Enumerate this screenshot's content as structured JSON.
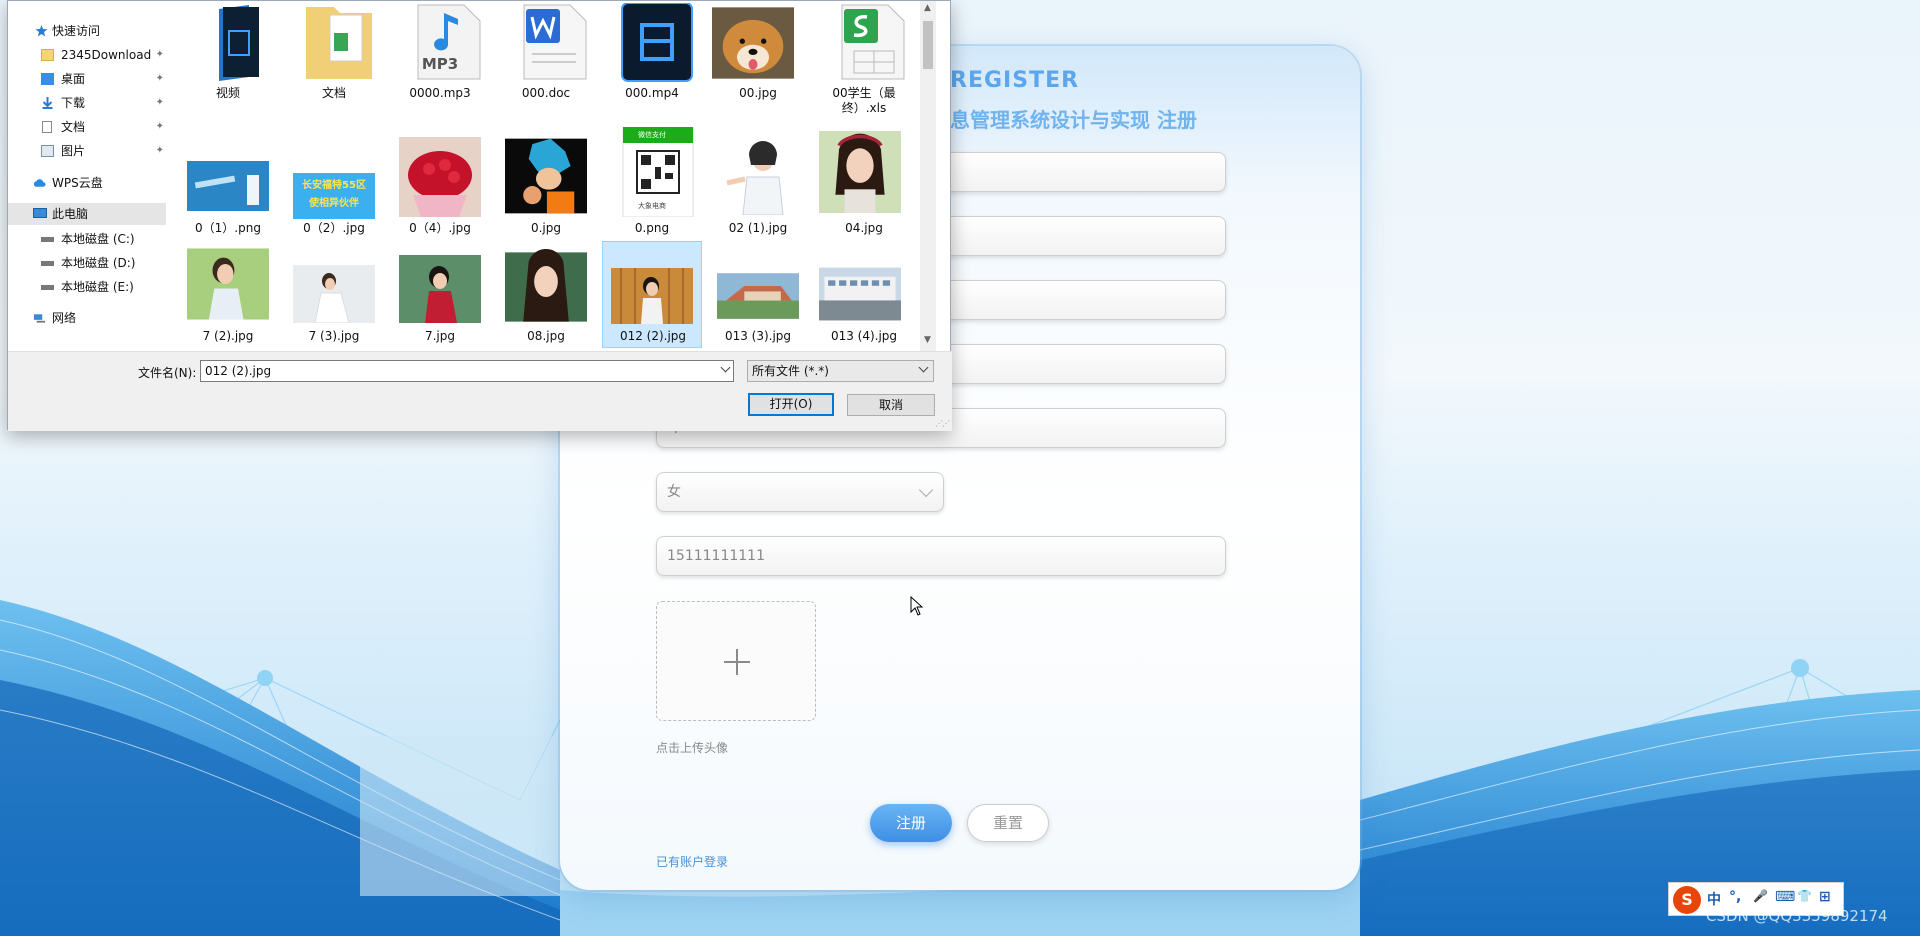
{
  "register": {
    "title_en": "REGISTER",
    "title_cn": "息管理系统设计与实现 注册",
    "fields": [
      {
        "value": ""
      },
      {
        "value": ""
      },
      {
        "value": ""
      },
      {
        "value": ""
      },
      {
        "value": "吓"
      },
      {
        "value": "女"
      },
      {
        "value": "15111111111"
      }
    ],
    "upload_tip": "点击上传头像",
    "register_button": "注册",
    "reset_button": "重置",
    "login_link": "已有账户登录"
  },
  "dialog": {
    "nav": [
      {
        "label": "快速访问",
        "icon": "star-icon"
      },
      {
        "label": "2345Download",
        "icon": "folder-icon",
        "pinned": true
      },
      {
        "label": "桌面",
        "icon": "desktop-icon",
        "pinned": true
      },
      {
        "label": "下载",
        "icon": "download-icon",
        "pinned": true
      },
      {
        "label": "文档",
        "icon": "document-icon",
        "pinned": true
      },
      {
        "label": "图片",
        "icon": "picture-icon",
        "pinned": true
      },
      {
        "label": "WPS云盘",
        "icon": "cloud-icon"
      },
      {
        "label": "此电脑",
        "icon": "computer-icon",
        "selected": true
      },
      {
        "label": "本地磁盘 (C:)",
        "icon": "drive-icon"
      },
      {
        "label": "本地磁盘 (D:)",
        "icon": "drive-icon"
      },
      {
        "label": "本地磁盘 (E:)",
        "icon": "drive-icon"
      },
      {
        "label": "网络",
        "icon": "network-icon"
      }
    ],
    "pin_glyph": "✦",
    "files": [
      {
        "name": "视频",
        "kind": "folder-video"
      },
      {
        "name": "文档",
        "kind": "folder-doc"
      },
      {
        "name": "0000.mp3",
        "kind": "mp3"
      },
      {
        "name": "000.doc",
        "kind": "doc"
      },
      {
        "name": "000.mp4",
        "kind": "mp4"
      },
      {
        "name": "00.jpg",
        "kind": "dog"
      },
      {
        "name": "00学生（最终）.xls",
        "kind": "xls"
      },
      {
        "name": "0（1）.png",
        "kind": "vaccine"
      },
      {
        "name": "0（2）.jpg",
        "kind": "banner"
      },
      {
        "name": "0（4）.jpg",
        "kind": "roses"
      },
      {
        "name": "0.jpg",
        "kind": "anime"
      },
      {
        "name": "0.png",
        "kind": "qr"
      },
      {
        "name": "02 (1).jpg",
        "kind": "doctor"
      },
      {
        "name": "04.jpg",
        "kind": "girl1"
      },
      {
        "name": "7 (2).jpg",
        "kind": "girl2"
      },
      {
        "name": "7 (3).jpg",
        "kind": "girl3"
      },
      {
        "name": "7.jpg",
        "kind": "girl4"
      },
      {
        "name": "08.jpg",
        "kind": "girl5"
      },
      {
        "name": "012 (2).jpg",
        "kind": "girl6",
        "selected": true
      },
      {
        "name": "013 (3).jpg",
        "kind": "campus1"
      },
      {
        "name": "013 (4).jpg",
        "kind": "campus2"
      }
    ],
    "banner_text": "长安福特55区 使相异伙伴",
    "mp3_label": "MP3",
    "qr_top_text": "微信支付",
    "qr_bottom_text": "大象电商",
    "filename_label": "文件名(N):",
    "filename_value": "012 (2).jpg",
    "filetype_value": "所有文件 (*.*)",
    "open_button": "打开(O)",
    "cancel_button": "取消"
  },
  "tray": {
    "ime_logo": "S",
    "ime_items": [
      "中",
      "°,",
      "🎤",
      "⌨",
      "👕",
      "⊞"
    ],
    "watermark": "CSDN @QQ3359892174"
  },
  "colors": {
    "accent": "#3d8fe6",
    "dialog_selection": "#cce8ff",
    "wave_blue": "#1e7fd0"
  }
}
